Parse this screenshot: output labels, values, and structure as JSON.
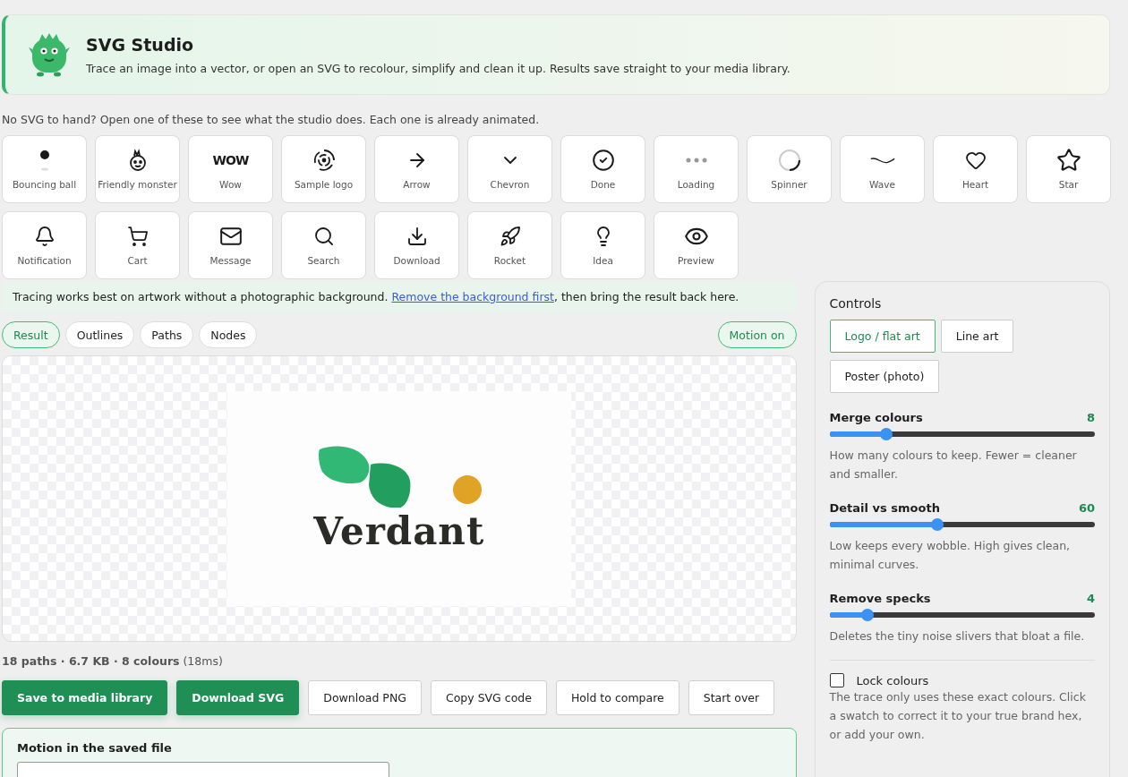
{
  "header": {
    "title": "SVG Studio",
    "subtitle": "Trace an image into a vector, or open an SVG to recolour, simplify and clean it up. Results save straight to your media library."
  },
  "samples_intro": "No SVG to hand? Open one of these to see what the studio does. Each one is already animated.",
  "samples": [
    {
      "label": "Bouncing ball",
      "kind": "ball"
    },
    {
      "label": "Friendly monster",
      "kind": "monster"
    },
    {
      "label": "Wow",
      "kind": "text",
      "glyph": "WOW"
    },
    {
      "label": "Sample logo",
      "kind": "logo"
    },
    {
      "label": "Arrow",
      "kind": "arrow"
    },
    {
      "label": "Chevron",
      "kind": "chevron"
    },
    {
      "label": "Done",
      "kind": "check"
    },
    {
      "label": "Loading",
      "kind": "dots"
    },
    {
      "label": "Spinner",
      "kind": "spinner"
    },
    {
      "label": "Wave",
      "kind": "wave"
    },
    {
      "label": "Heart",
      "kind": "heart"
    },
    {
      "label": "Star",
      "kind": "star"
    },
    {
      "label": "Notification",
      "kind": "bell"
    },
    {
      "label": "Cart",
      "kind": "cart"
    },
    {
      "label": "Message",
      "kind": "mail"
    },
    {
      "label": "Search",
      "kind": "search"
    },
    {
      "label": "Download",
      "kind": "download"
    },
    {
      "label": "Rocket",
      "kind": "rocket"
    },
    {
      "label": "Idea",
      "kind": "bulb"
    },
    {
      "label": "Preview",
      "kind": "eye"
    }
  ],
  "tip": {
    "before": "Tracing works best on artwork without a photographic background. ",
    "link": "Remove the background first",
    "after": ", then bring the result back here."
  },
  "view_tabs": [
    {
      "label": "Result",
      "selected": true
    },
    {
      "label": "Outlines",
      "selected": false
    },
    {
      "label": "Paths",
      "selected": false
    },
    {
      "label": "Nodes",
      "selected": false
    }
  ],
  "motion_toggle": {
    "label": "Motion on",
    "on": true
  },
  "preview": {
    "wordmark": "Verdant"
  },
  "stats": {
    "main": "18 paths · 6.7 KB · 8 colours",
    "timing": "(18ms)"
  },
  "actions": [
    {
      "label": "Save to media library",
      "kind": "primary"
    },
    {
      "label": "Download SVG",
      "kind": "primary"
    },
    {
      "label": "Download PNG",
      "kind": "secondary"
    },
    {
      "label": "Copy SVG code",
      "kind": "secondary"
    },
    {
      "label": "Hold to compare",
      "kind": "secondary"
    },
    {
      "label": "Start over",
      "kind": "secondary"
    }
  ],
  "motion_section": {
    "title": "Motion in the saved file"
  },
  "controls": {
    "title": "Controls",
    "presets": [
      {
        "label": "Logo / flat art",
        "selected": true
      },
      {
        "label": "Line art",
        "selected": false
      },
      {
        "label": "Poster (photo)",
        "selected": false
      }
    ],
    "sliders": [
      {
        "label": "Merge colours",
        "reading": "8",
        "level": 0.215,
        "hint": "How many colours to keep. Fewer = cleaner and smaller."
      },
      {
        "label": "Detail vs smooth",
        "reading": "60",
        "level": 0.405,
        "hint": "Low keeps every wobble. High gives clean, minimal curves."
      },
      {
        "label": "Remove specks",
        "reading": "4",
        "level": 0.144,
        "hint": "Deletes the tiny noise slivers that bloat a file."
      }
    ],
    "lock": {
      "label": "Lock colours",
      "checked": false,
      "hint": "The trace only uses these exact colours. Click a swatch to correct it to your true brand hex, or add your own."
    }
  }
}
